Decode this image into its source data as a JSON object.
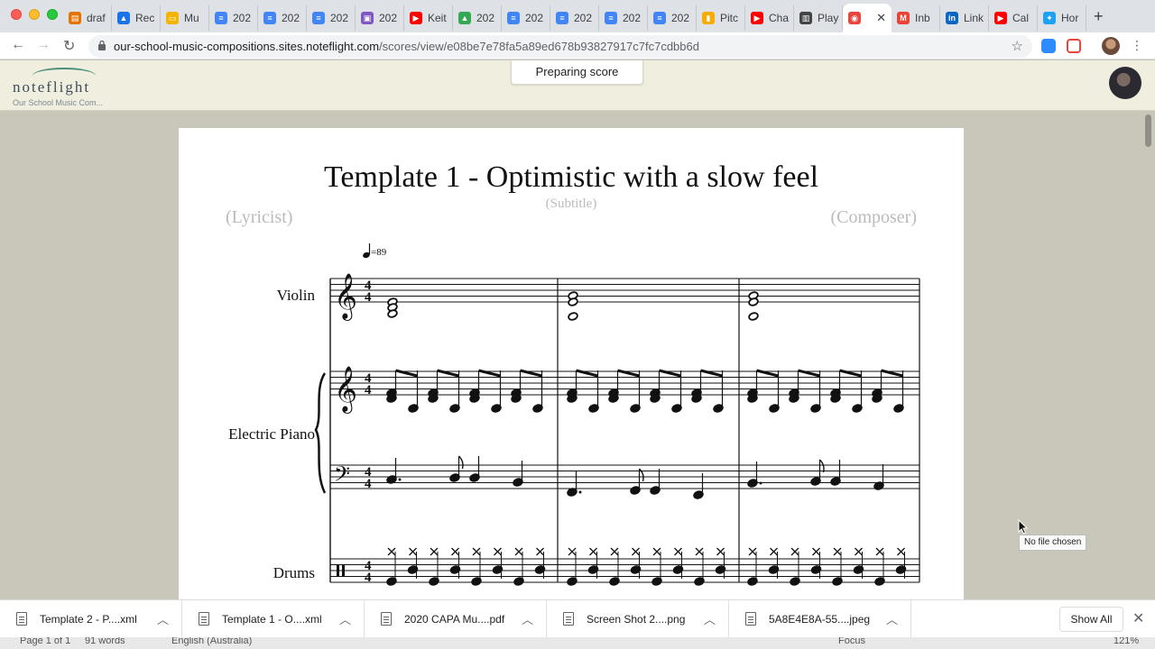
{
  "browser": {
    "tabs": [
      {
        "title": "draf",
        "color": "#e37400",
        "glyph": "▤"
      },
      {
        "title": "Rec",
        "color": "#1a73e8",
        "glyph": "▲"
      },
      {
        "title": "Mu",
        "color": "#f4b400",
        "glyph": "▭"
      },
      {
        "title": "202",
        "color": "#4285f4",
        "glyph": "≡"
      },
      {
        "title": "202",
        "color": "#4285f4",
        "glyph": "≡"
      },
      {
        "title": "202",
        "color": "#4285f4",
        "glyph": "≡"
      },
      {
        "title": "202",
        "color": "#7e57c2",
        "glyph": "▣"
      },
      {
        "title": "Keit",
        "color": "#ff0000",
        "glyph": "▶"
      },
      {
        "title": "202",
        "color": "#34a853",
        "glyph": "▲"
      },
      {
        "title": "202",
        "color": "#4285f4",
        "glyph": "≡"
      },
      {
        "title": "202",
        "color": "#4285f4",
        "glyph": "≡"
      },
      {
        "title": "202",
        "color": "#4285f4",
        "glyph": "≡"
      },
      {
        "title": "202",
        "color": "#4285f4",
        "glyph": "≡"
      },
      {
        "title": "Pitc",
        "color": "#f9ab00",
        "glyph": "▮"
      },
      {
        "title": "Cha",
        "color": "#ff0000",
        "glyph": "▶"
      },
      {
        "title": "Play",
        "color": "#444444",
        "glyph": "▥"
      },
      {
        "title": "",
        "color": "#e8453c",
        "glyph": "◉",
        "active": true
      },
      {
        "title": "Inb",
        "color": "#ea4335",
        "glyph": "M"
      },
      {
        "title": "Link",
        "color": "#0a66c2",
        "glyph": "in"
      },
      {
        "title": "Cal",
        "color": "#ff0000",
        "glyph": "▶"
      },
      {
        "title": "Hor",
        "color": "#1da1f2",
        "glyph": "✦"
      }
    ],
    "new_tab_label": "+",
    "url_host": "our-school-music-compositions.sites.noteflight.com",
    "url_path": "/scores/view/e08be7e78fa5a89ed678b93827917c7fc7cdbb6d"
  },
  "app": {
    "logo_text": "noteflight",
    "site_name": "Our School Music Com...",
    "status_toast": "Preparing score"
  },
  "score": {
    "title": "Template 1 - Optimistic with a slow feel",
    "subtitle": "(Subtitle)",
    "lyricist": "(Lyricist)",
    "composer": "(Composer)",
    "tempo_text": "=89",
    "time_signature": "4/4",
    "instruments": [
      "Violin",
      "Electric Piano",
      "Drums"
    ]
  },
  "tooltip": "No file chosen",
  "downloads": {
    "items": [
      {
        "name": "Template 2 - P....xml"
      },
      {
        "name": "Template 1 - O....xml"
      },
      {
        "name": "2020 CAPA Mu....pdf"
      },
      {
        "name": "Screen Shot 2....png"
      },
      {
        "name": "5A8E4E8A-55....jpeg"
      }
    ],
    "show_all": "Show All"
  },
  "statusbar": {
    "page": "Page 1 of 1",
    "words": "91 words",
    "language": "English (Australia)",
    "focus": "Focus",
    "zoom": "121%"
  },
  "colors": {
    "app_header": "#f0eedf",
    "canvas": "#c9c7b9",
    "logo_arc": "#4a8f7a"
  }
}
